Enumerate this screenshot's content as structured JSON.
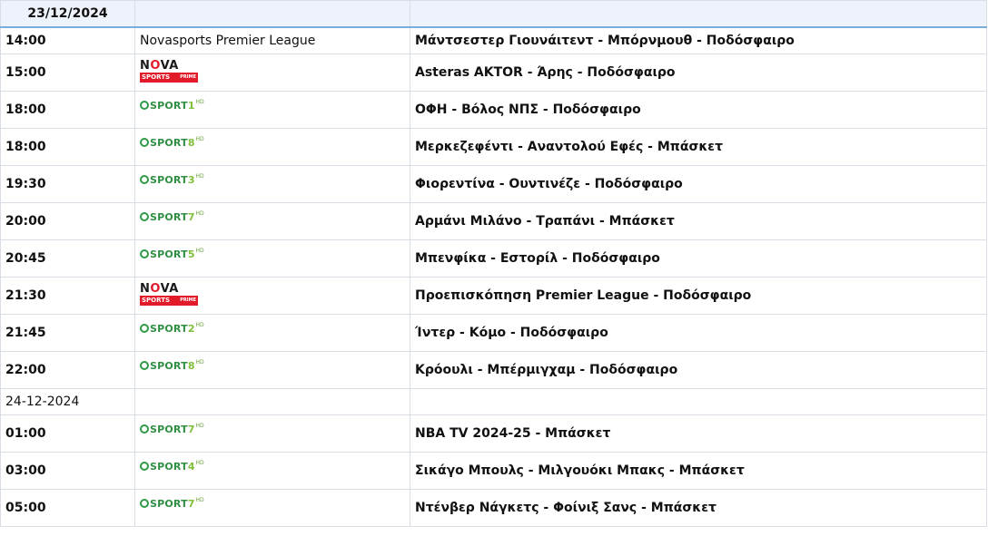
{
  "header": {
    "date": "23/12/2024"
  },
  "rows": [
    {
      "kind": "channel-text",
      "time": "14:00",
      "channel": {
        "type": "text",
        "label": "Novasports Premier League"
      },
      "title": "Μάντσεστερ Γιουνάιτεντ - Μπόρνμουθ - Ποδόσφαιρο"
    },
    {
      "kind": "event",
      "time": "15:00",
      "channel": {
        "type": "nova"
      },
      "title": "Asteras AKTOR - Άρης - Ποδόσφαιρο"
    },
    {
      "kind": "event",
      "time": "18:00",
      "channel": {
        "type": "sport",
        "number": "1"
      },
      "title": "ΟΦΗ - Βόλος ΝΠΣ - Ποδόσφαιρο"
    },
    {
      "kind": "event",
      "time": "18:00",
      "channel": {
        "type": "sport",
        "number": "8"
      },
      "title": "Μερκεζεφέντι - Αναντολού Εφές - Μπάσκετ"
    },
    {
      "kind": "event",
      "time": "19:30",
      "channel": {
        "type": "sport",
        "number": "3"
      },
      "title": "Φιορεντίνα - Ουντινέζε - Ποδόσφαιρο"
    },
    {
      "kind": "event",
      "time": "20:00",
      "channel": {
        "type": "sport",
        "number": "7"
      },
      "title": "Αρμάνι Μιλάνο - Τραπάνι - Μπάσκετ"
    },
    {
      "kind": "event",
      "time": "20:45",
      "channel": {
        "type": "sport",
        "number": "5"
      },
      "title": "Μπενφίκα - Εστορίλ - Ποδόσφαιρο"
    },
    {
      "kind": "event",
      "time": "21:30",
      "channel": {
        "type": "nova"
      },
      "title": "Προεπισκόπηση Premier League - Ποδόσφαιρο"
    },
    {
      "kind": "event",
      "time": "21:45",
      "channel": {
        "type": "sport",
        "number": "2"
      },
      "title": "Ίντερ - Κόμο - Ποδόσφαιρο"
    },
    {
      "kind": "event",
      "time": "22:00",
      "channel": {
        "type": "sport",
        "number": "8"
      },
      "title": "Κρόουλι - Μπέρμιγχαμ - Ποδόσφαιρο"
    },
    {
      "kind": "date",
      "label": "24-12-2024"
    },
    {
      "kind": "event",
      "time": "01:00",
      "channel": {
        "type": "sport",
        "number": "7"
      },
      "title": "NBA TV 2024-25 - Μπάσκετ"
    },
    {
      "kind": "event",
      "time": "03:00",
      "channel": {
        "type": "sport",
        "number": "4"
      },
      "title": "Σικάγο Μπουλς - Μιλγουόκι Μπακς - Μπάσκετ"
    },
    {
      "kind": "event",
      "time": "05:00",
      "channel": {
        "type": "sport",
        "number": "7"
      },
      "title": "Ντένβερ Νάγκετς - Φοίνιξ Σανς - Μπάσκετ"
    }
  ],
  "logos": {
    "nova": {
      "word_prefix": "N",
      "word_o": "O",
      "word_suffix": "VA",
      "bar": "SPORTS",
      "bar_tag": "PRIME"
    },
    "sport": {
      "word": "SPORT",
      "suffix": "HD"
    }
  },
  "colors": {
    "header_bg": "#eef3fb",
    "header_rule": "#7aaed8",
    "grid": "#d8dde6",
    "nova_red": "#e21b2a",
    "sport_green": "#2e8f43",
    "sport_lime": "#7fbf3a"
  }
}
